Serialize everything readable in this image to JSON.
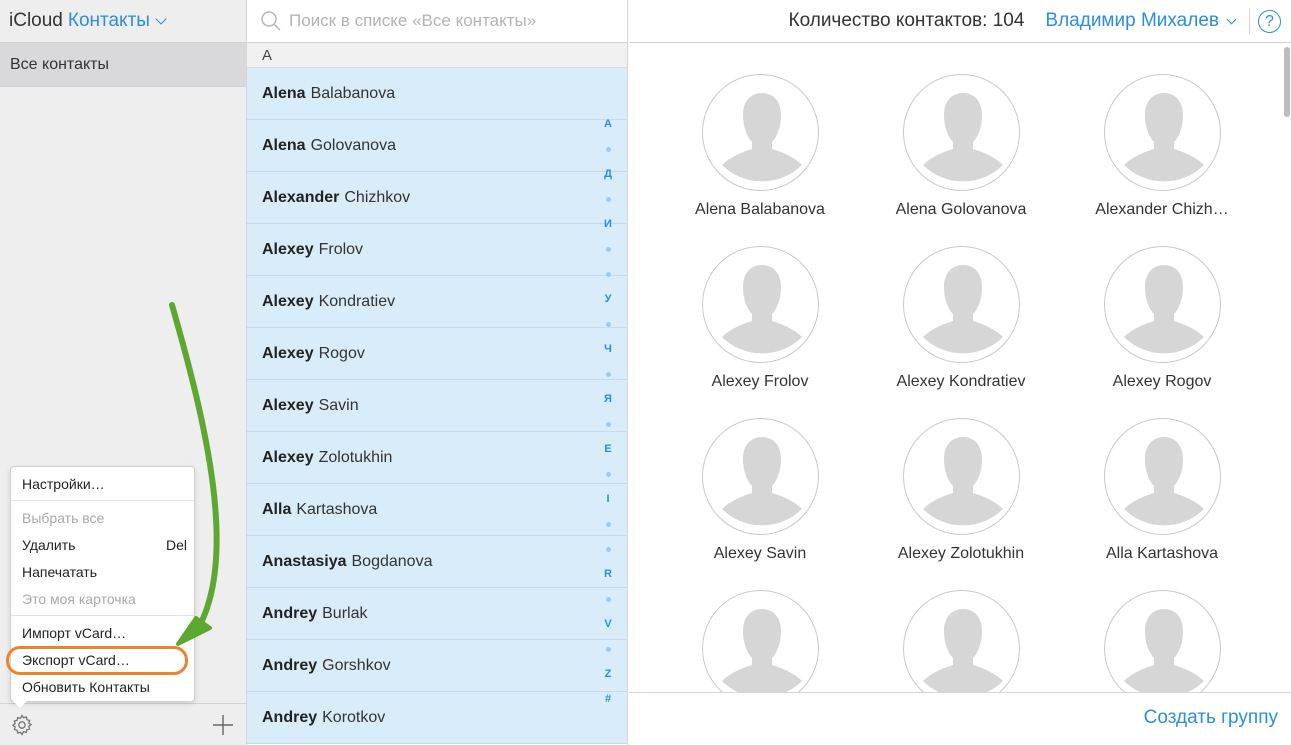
{
  "sidebar": {
    "brand": "iCloud",
    "app_name": "Контакты",
    "group_all": "Все контакты"
  },
  "menu": {
    "items": [
      {
        "label": "Настройки…",
        "shortcut": "",
        "disabled": false
      },
      {
        "label": "Выбрать все",
        "shortcut": "",
        "disabled": true
      },
      {
        "label": "Удалить",
        "shortcut": "Del",
        "disabled": false
      },
      {
        "label": "Напечатать",
        "shortcut": "",
        "disabled": false
      },
      {
        "label": "Это моя карточка",
        "shortcut": "",
        "disabled": true
      },
      {
        "label": "Импорт vCard…",
        "shortcut": "",
        "disabled": false
      },
      {
        "label": "Экспорт vCard…",
        "shortcut": "",
        "disabled": false
      },
      {
        "label": "Обновить Контакты",
        "shortcut": "",
        "disabled": false
      }
    ]
  },
  "search": {
    "placeholder": "Поиск в списке «Все контакты»"
  },
  "list": {
    "section": "A",
    "contacts": [
      {
        "first": "Alena",
        "last": "Balabanova"
      },
      {
        "first": "Alena",
        "last": "Golovanova"
      },
      {
        "first": "Alexander",
        "last": "Chizhkov"
      },
      {
        "first": "Alexey",
        "last": "Frolov"
      },
      {
        "first": "Alexey",
        "last": "Kondratiev"
      },
      {
        "first": "Alexey",
        "last": "Rogov"
      },
      {
        "first": "Alexey",
        "last": "Savin"
      },
      {
        "first": "Alexey",
        "last": "Zolotukhin"
      },
      {
        "first": "Alla",
        "last": "Kartashova"
      },
      {
        "first": "Anastasiya",
        "last": "Bogdanova"
      },
      {
        "first": "Andrey",
        "last": "Burlak"
      },
      {
        "first": "Andrey",
        "last": "Gorshkov"
      },
      {
        "first": "Andrey",
        "last": "Korotkov"
      }
    ],
    "index": [
      "А",
      "•",
      "Д",
      "•",
      "И",
      "•",
      "•",
      "У",
      "•",
      "Ч",
      "•",
      "Я",
      "•",
      "E",
      "•",
      "I",
      "•",
      "•",
      "R",
      "•",
      "V",
      "•",
      "Z",
      "#"
    ]
  },
  "header": {
    "count_label": "Количество контактов: 104",
    "user_name": "Владимир Михалев",
    "help": "?"
  },
  "grid": {
    "cards": [
      "Alena Balabanova",
      "Alena Golovanova",
      "Alexander Chizh…",
      "Alexey Frolov",
      "Alexey Kondratiev",
      "Alexey Rogov",
      "Alexey Savin",
      "Alexey Zolotukhin",
      "Alla Kartashova",
      "",
      "",
      ""
    ]
  },
  "footer": {
    "create_group": "Создать группу"
  },
  "colors": {
    "accent": "#2b8ee0",
    "selection": "#d9ecfa",
    "highlight_ring": "#e9852d",
    "arrow": "#5ea832"
  }
}
